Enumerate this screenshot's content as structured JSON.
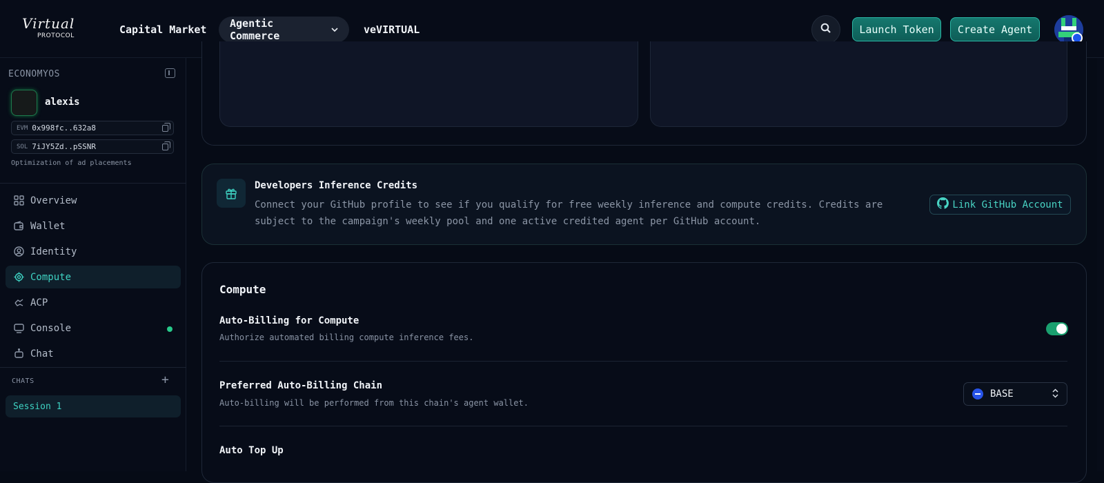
{
  "header": {
    "logo_script": "Virtual",
    "logo_sub": "PROTOCOL",
    "nav": [
      "Capital Market",
      "Agentic Commerce",
      "veVIRTUAL"
    ],
    "nav_dropdown_chevron": "⌄",
    "launch_token": "Launch Token",
    "create_agent": "Create Agent"
  },
  "sidebar": {
    "title": "ECONOMYOS",
    "agent_name": "alexis",
    "addresses": [
      {
        "chain": "EVM",
        "value": "0x998fc..632a8"
      },
      {
        "chain": "SOL",
        "value": "7iJY5Zd..pSSNR"
      }
    ],
    "agent_description": "Optimization of ad placements",
    "menu": [
      {
        "label": "Overview",
        "icon": "grid-icon"
      },
      {
        "label": "Wallet",
        "icon": "wallet-icon"
      },
      {
        "label": "Identity",
        "icon": "user-circle-icon"
      },
      {
        "label": "Compute",
        "icon": "compute-icon"
      },
      {
        "label": "ACP",
        "icon": "acp-icon"
      },
      {
        "label": "Console",
        "icon": "console-icon"
      },
      {
        "label": "Chat",
        "icon": "chat-icon"
      }
    ],
    "active_item": "Compute",
    "chats_title": "CHATS",
    "chats_plus": "+",
    "sessions": [
      "Session 1"
    ]
  },
  "credits": {
    "title": "Developers Inference Credits",
    "text": "Connect your GitHub profile to see if you qualify for free weekly inference and compute credits. Credits are subject to the campaign's weekly pool and one active credited agent per GitHub account.",
    "button": "Link GitHub Account"
  },
  "compute": {
    "title": "Compute",
    "auto_billing_title": "Auto-Billing for Compute",
    "auto_billing_desc": "Authorize automated billing compute inference fees.",
    "auto_billing_enabled": true,
    "chain_title": "Preferred Auto-Billing Chain",
    "chain_desc": "Auto-billing will be performed from this chain's agent wallet.",
    "chain_value": "BASE",
    "top_up_title": "Auto Top Up"
  },
  "colors": {
    "accent": "#3ed2c2",
    "primary_button": "#15786e",
    "toggle_on": "#1aa06f",
    "status_green": "#27c98a",
    "base_chain": "#2753e8"
  }
}
